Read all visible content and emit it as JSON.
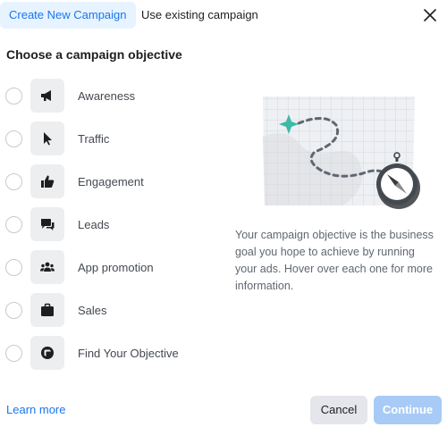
{
  "tabs": {
    "create_new": "Create New Campaign",
    "use_existing": "Use existing campaign"
  },
  "heading": "Choose a campaign objective",
  "objectives": [
    {
      "label": "Awareness",
      "icon": "megaphone-icon"
    },
    {
      "label": "Traffic",
      "icon": "cursor-icon"
    },
    {
      "label": "Engagement",
      "icon": "thumbs-up-icon"
    },
    {
      "label": "Leads",
      "icon": "chat-bubbles-icon"
    },
    {
      "label": "App promotion",
      "icon": "people-icon"
    },
    {
      "label": "Sales",
      "icon": "briefcase-icon"
    },
    {
      "label": "Find Your Objective",
      "icon": "target-icon"
    }
  ],
  "description": "Your campaign objective is the business goal you hope to achieve by running your ads. Hover over each one for more information.",
  "footer": {
    "learn_more": "Learn more",
    "cancel": "Cancel",
    "continue": "Continue"
  },
  "colors": {
    "accent": "#1877f2",
    "tab_active_bg": "#e7f3ff",
    "continue_disabled_bg": "#a7cbf6",
    "map_star": "#3dbba6"
  }
}
